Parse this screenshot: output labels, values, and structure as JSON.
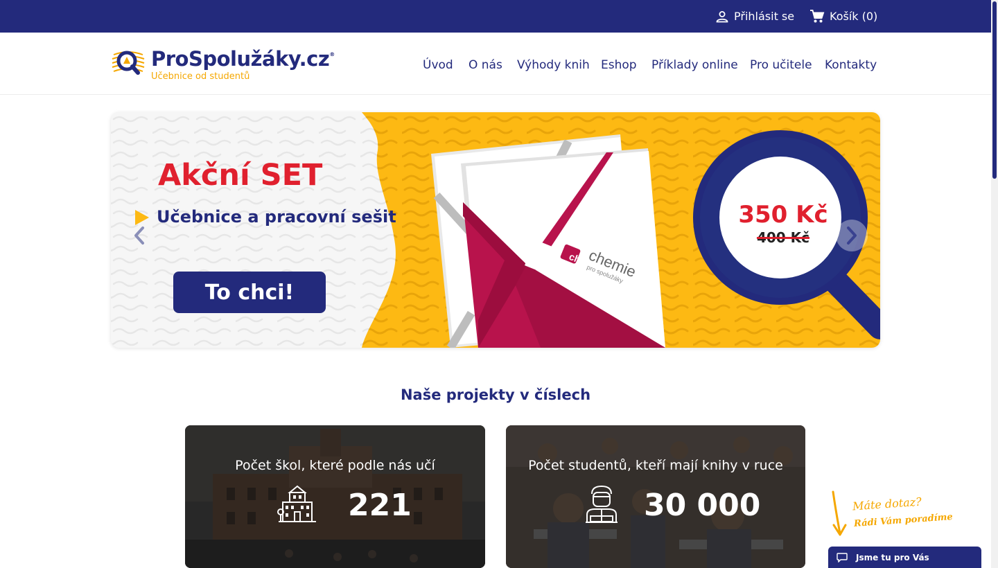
{
  "topbar": {
    "login_label": "Přihlásit se",
    "login_icon": "user-icon",
    "cart_label": "Košík (0)",
    "cart_icon": "cart-icon"
  },
  "header": {
    "logo_name": "ProSpolužáky.cz",
    "logo_registered": "®",
    "logo_tagline": "Učebnice od studentů",
    "nav": [
      "Úvod",
      "O nás",
      "Výhody knih",
      "Eshop",
      "Příklady online",
      "Pro učitele",
      "Kontakty"
    ]
  },
  "hero": {
    "title": "Akční SET",
    "subtitle": "Učebnice a pracovní sešit",
    "cta_label": "To chci!",
    "price_new": "350 Kč",
    "price_old": "400 Kč",
    "book_brand": "chemie",
    "book_brand_sub": "pro spolužáky",
    "book_badge": "ch",
    "prev_icon": "chevron-left-icon",
    "next_icon": "chevron-right-icon"
  },
  "stats": {
    "title": "Naše projekty v číslech",
    "items": [
      {
        "label": "Počet škol, které podle nás učí",
        "value": "221",
        "icon": "school-building-icon"
      },
      {
        "label": "Počet studentů, kteří mají knihy v ruce",
        "value": "30 000",
        "icon": "student-icon"
      }
    ]
  },
  "chat": {
    "hint_line1": "Máte dotaz?",
    "hint_line2": "Rádi Vám poradíme",
    "bar_label": "Jsme tu pro Vás",
    "bar_icon": "chat-bubble-icon"
  },
  "colors": {
    "brand_navy": "#232a7c",
    "brand_yellow": "#fdb913",
    "accent_red": "#e0202e",
    "book_magenta": "#b8134c"
  }
}
